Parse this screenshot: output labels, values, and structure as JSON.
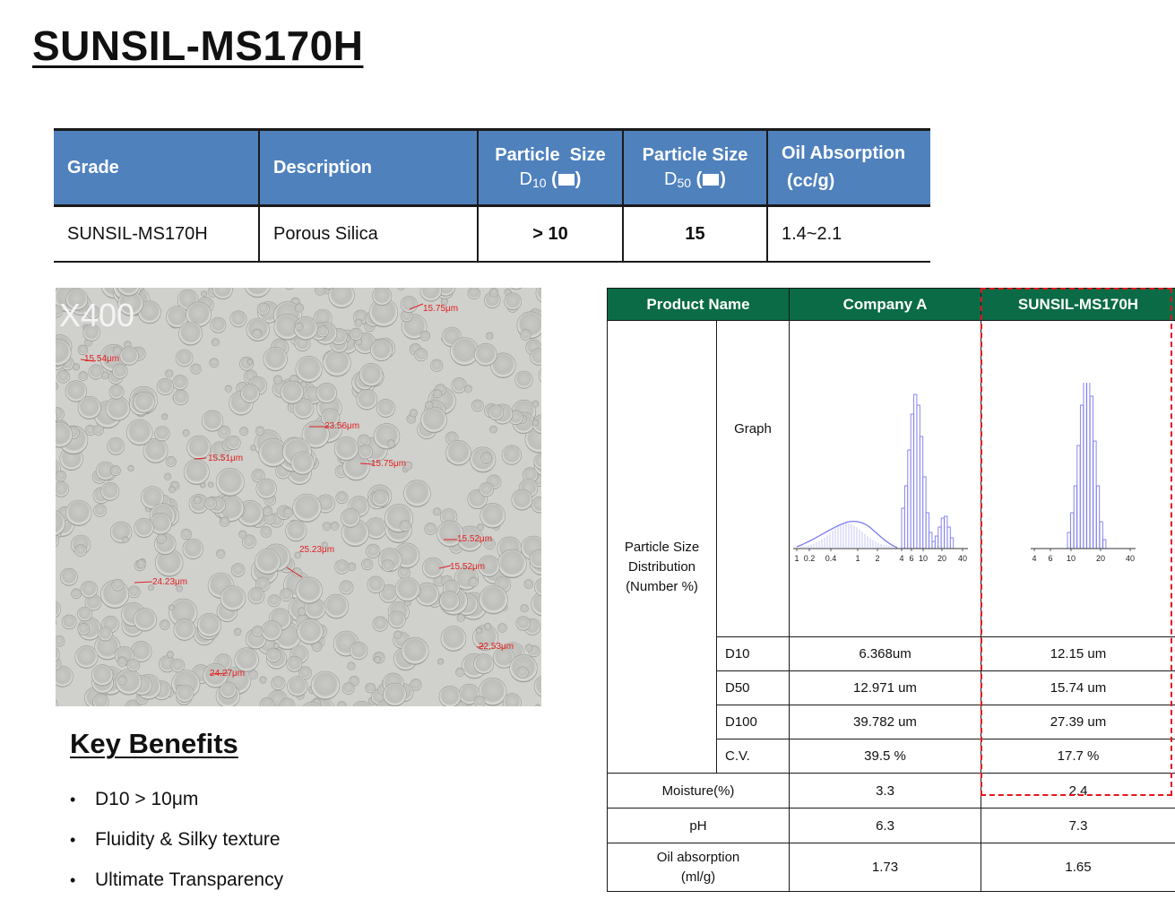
{
  "title": "SUNSIL-MS170H",
  "spec_table": {
    "headers": {
      "grade": "Grade",
      "description": "Description",
      "d10_label": "Particle  Size",
      "d10_sym": "D",
      "d10_sub": "10",
      "d50_label": "Particle Size",
      "d50_sym": "D",
      "d50_sub": "50",
      "unit_open": "(",
      "unit_close": ")",
      "oil_line1": "Oil Absorption",
      "oil_line2": "(cc/g)"
    },
    "row": {
      "grade": "SUNSIL-MS170H",
      "description": "Porous Silica",
      "d10": "> 10",
      "d50": "15",
      "oil": "1.4~2.1"
    }
  },
  "micrograph": {
    "magnification": "X400",
    "labels": [
      "15.75μm",
      "15.54μm",
      "23.56μm",
      "15.51μm",
      "15.75μm",
      "15.52μm",
      "15.52μm",
      "25.23μm",
      "24.23μm",
      "22.53μm",
      "24.27μm"
    ]
  },
  "key_benefits": {
    "title": "Key Benefits",
    "items": [
      "D10 > 10μm",
      "Fluidity & Silky texture",
      "Ultimate Transparency"
    ]
  },
  "comparison": {
    "headers": [
      "Product Name",
      "Company A",
      "SUNSIL-MS170H"
    ],
    "group_label_1": "Particle Size",
    "group_label_2": "Distribution",
    "group_label_3": "(Number %)",
    "graph_label": "Graph",
    "rows": [
      {
        "label": "D10",
        "a": "6.368um",
        "b": "12.15 um"
      },
      {
        "label": "D50",
        "a": "12.971 um",
        "b": "15.74 um"
      },
      {
        "label": "D100",
        "a": "39.782 um",
        "b": "27.39 um"
      },
      {
        "label": "C.V.",
        "a": "39.5 %",
        "b": "17.7 %"
      }
    ],
    "moisture": {
      "label": "Moisture(%)",
      "a": "3.3",
      "b": "2.4"
    },
    "ph": {
      "label": "pH",
      "a": "6.3",
      "b": "7.3"
    },
    "oil": {
      "label_1": "Oil absorption",
      "label_2": "(ml/g)",
      "a": "1.73",
      "b": "1.65"
    },
    "chart_a_ticks": [
      "1",
      "0.2",
      "0.4",
      "1",
      "2",
      "4",
      "6",
      "10",
      "20",
      "40"
    ],
    "chart_b_ticks": [
      "4",
      "6",
      "10",
      "20",
      "40"
    ]
  },
  "colors": {
    "header_blue": "#4f81bd",
    "header_green": "#0a6b46",
    "highlight_red": "#e8141a",
    "histogram": "#7b7bf0"
  }
}
